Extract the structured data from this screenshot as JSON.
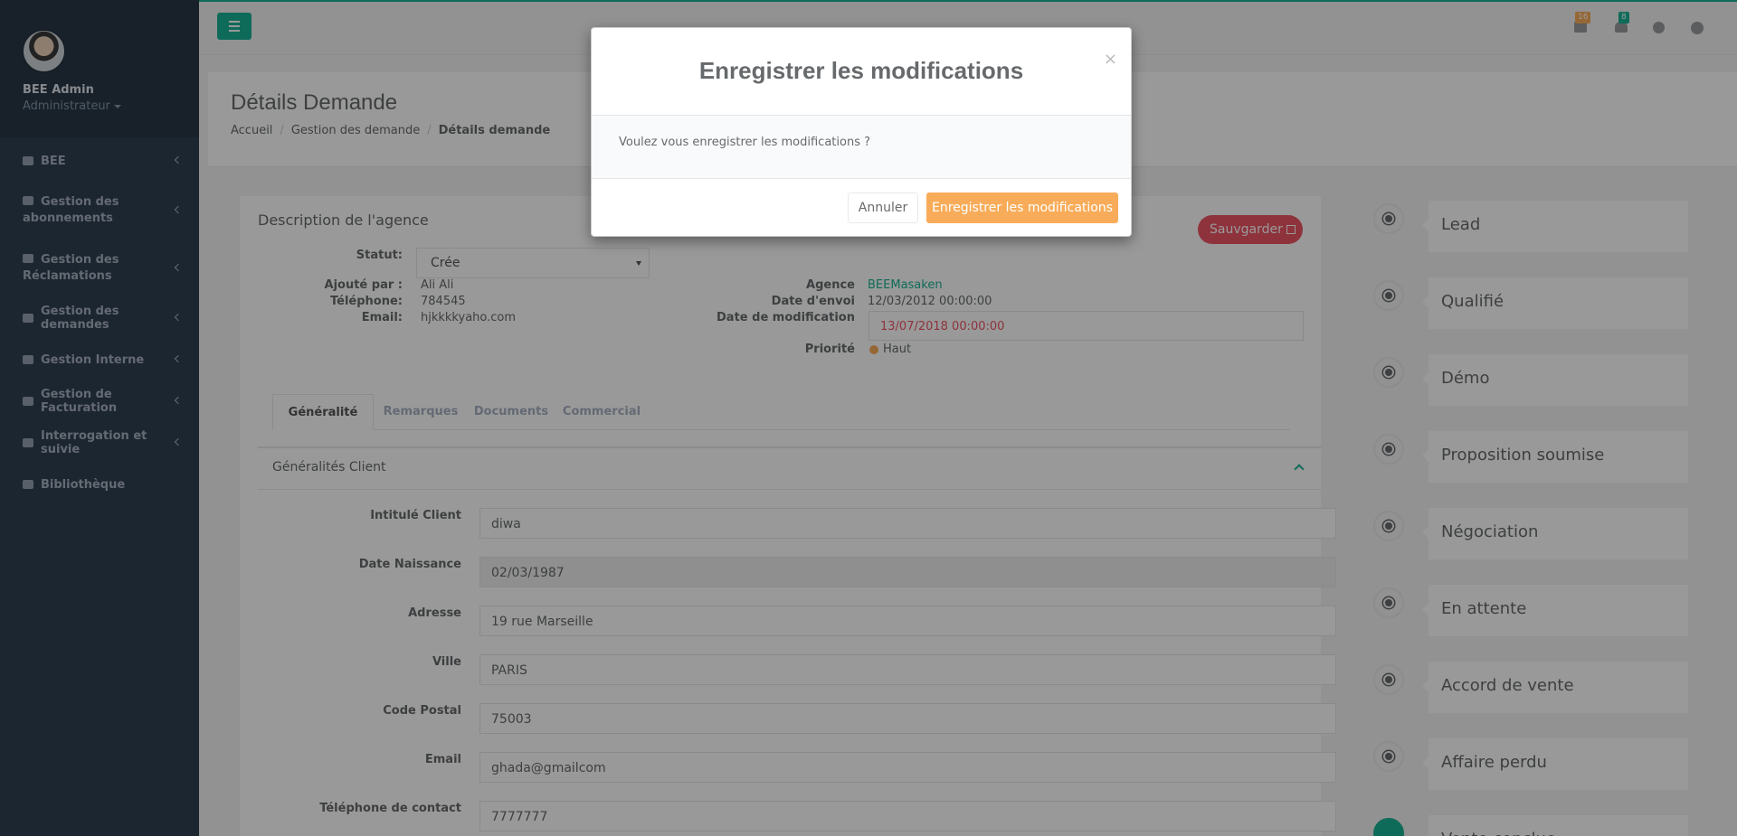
{
  "sidebar": {
    "user_name": "BEE Admin",
    "user_role": "Administrateur",
    "items": [
      {
        "label": "BEE",
        "icon": "dashboard-icon"
      },
      {
        "label": "Gestion des abonnements",
        "icon": "grid-icon"
      },
      {
        "label": "Gestion des Réclamations",
        "icon": "bar-chart-icon"
      },
      {
        "label": "Gestion des demandes",
        "icon": "envelope-icon"
      },
      {
        "label": "Gestion Interne",
        "icon": "edit-icon"
      },
      {
        "label": "Gestion de Facturation",
        "icon": "desktop-icon"
      },
      {
        "label": "Interrogation et suivie",
        "icon": "pie-chart-icon"
      },
      {
        "label": "Bibliothèque",
        "icon": "globe-icon"
      }
    ]
  },
  "topbar": {
    "messages_count": "16",
    "notifications_count": "8"
  },
  "heading": {
    "title": "Détails Demande",
    "breadcrumb": [
      "Accueil",
      "Gestion des demande",
      "Détails demande"
    ]
  },
  "agency": {
    "title": "Description de l'agence",
    "save_label": "Sauvgarder",
    "statut_label": "Statut:",
    "statut_value": "Crée",
    "added_by_label": "Ajouté par :",
    "added_by_value": "Ali Ali",
    "phone_label": "Téléphone:",
    "phone_value": "784545",
    "email_label": "Email:",
    "email_value": "hjkkkkyaho.com",
    "agence_label": "Agence",
    "agence_value": "BEEMasaken",
    "sent_label": "Date d'envoi",
    "sent_value": "12/03/2012 00:00:00",
    "modif_label": "Date de modification",
    "modif_value": "13/07/2018 00:00:00",
    "priority_label": "Priorité",
    "priority_value": "Haut"
  },
  "tabs": [
    "Généralité",
    "Remarques",
    "Documents",
    "Commercial"
  ],
  "section": {
    "title": "Généralités Client",
    "fields": [
      {
        "label": "Intitulé Client",
        "value": "diwa"
      },
      {
        "label": "Date Naissance",
        "value": "02/03/1987"
      },
      {
        "label": "Adresse",
        "value": "19 rue Marseille"
      },
      {
        "label": "Ville",
        "value": "PARIS"
      },
      {
        "label": "Code Postal",
        "value": "75003"
      },
      {
        "label": "Email",
        "value": "ghada@gmailcom"
      },
      {
        "label": "Téléphone de contact",
        "value": "7777777"
      }
    ]
  },
  "timeline": [
    "Lead",
    "Qualifié",
    "Démo",
    "Proposition soumise",
    "Négociation",
    "En attente",
    "Accord de vente",
    "Affaire perdu",
    "Vente conclue"
  ],
  "modal": {
    "title": "Enregistrer les modifications",
    "close": "×",
    "message": "Voulez vous enregistrer les modifications ?",
    "cancel_label": "Annuler",
    "confirm_label": "Enregistrer les modifications"
  },
  "colors": {
    "accent": "#1ab394",
    "danger": "#ed5565",
    "warning": "#f8ac59",
    "sidebar": "#2f4050"
  }
}
